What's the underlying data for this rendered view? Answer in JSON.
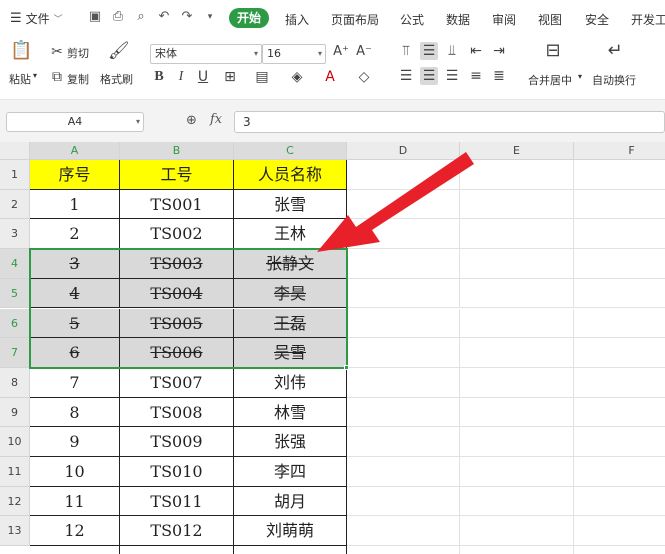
{
  "menu": {
    "file": "文件",
    "tabs": [
      "开始",
      "插入",
      "页面布局",
      "公式",
      "数据",
      "审阅",
      "视图",
      "安全",
      "开发工"
    ]
  },
  "ribbon": {
    "paste": "粘贴",
    "cut": "剪切",
    "copy": "复制",
    "format_painter": "格式刷",
    "font_name": "宋体",
    "font_size": "16",
    "merge_center": "合并居中",
    "wrap_text": "自动换行"
  },
  "formula_bar": {
    "name_box": "A4",
    "fx_label": "fx",
    "value": "3"
  },
  "columns": [
    "A",
    "B",
    "C",
    "D",
    "E",
    "F"
  ],
  "rows": [
    "1",
    "2",
    "3",
    "4",
    "5",
    "6",
    "7",
    "8",
    "9",
    "10",
    "11",
    "12",
    "13"
  ],
  "table": {
    "headers": [
      "序号",
      "工号",
      "人员名称"
    ],
    "rows": [
      [
        "1",
        "TS001",
        "张雪"
      ],
      [
        "2",
        "TS002",
        "王林"
      ],
      [
        "3",
        "TS003",
        "张静文"
      ],
      [
        "4",
        "TS004",
        "李昊"
      ],
      [
        "5",
        "TS005",
        "王磊"
      ],
      [
        "6",
        "TS006",
        "吴雪"
      ],
      [
        "7",
        "TS007",
        "刘伟"
      ],
      [
        "8",
        "TS008",
        "林雪"
      ],
      [
        "9",
        "TS009",
        "张强"
      ],
      [
        "10",
        "TS010",
        "李四"
      ],
      [
        "11",
        "TS011",
        "胡月"
      ],
      [
        "12",
        "TS012",
        "刘萌萌"
      ]
    ]
  },
  "colors": {
    "accent": "#2d9b45",
    "header_fill": "#ffff00",
    "struck_fill": "#d9d9d9",
    "arrow": "#e8202a"
  }
}
